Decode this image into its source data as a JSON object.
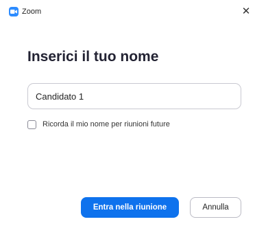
{
  "window": {
    "title": "Zoom",
    "app_icon": "zoom-camera-icon",
    "close_icon": "close-icon",
    "close_glyph": "✕"
  },
  "dialog": {
    "heading": "Inserici il tuo nome",
    "name_value": "Candidato 1",
    "remember_label": "Ricorda il mio nome per riunioni future",
    "remember_checked": false
  },
  "actions": {
    "join_label": "Entra nella riunione",
    "cancel_label": "Annulla"
  },
  "colors": {
    "accent": "#0e72ed",
    "app_icon": "#2d8cff"
  }
}
